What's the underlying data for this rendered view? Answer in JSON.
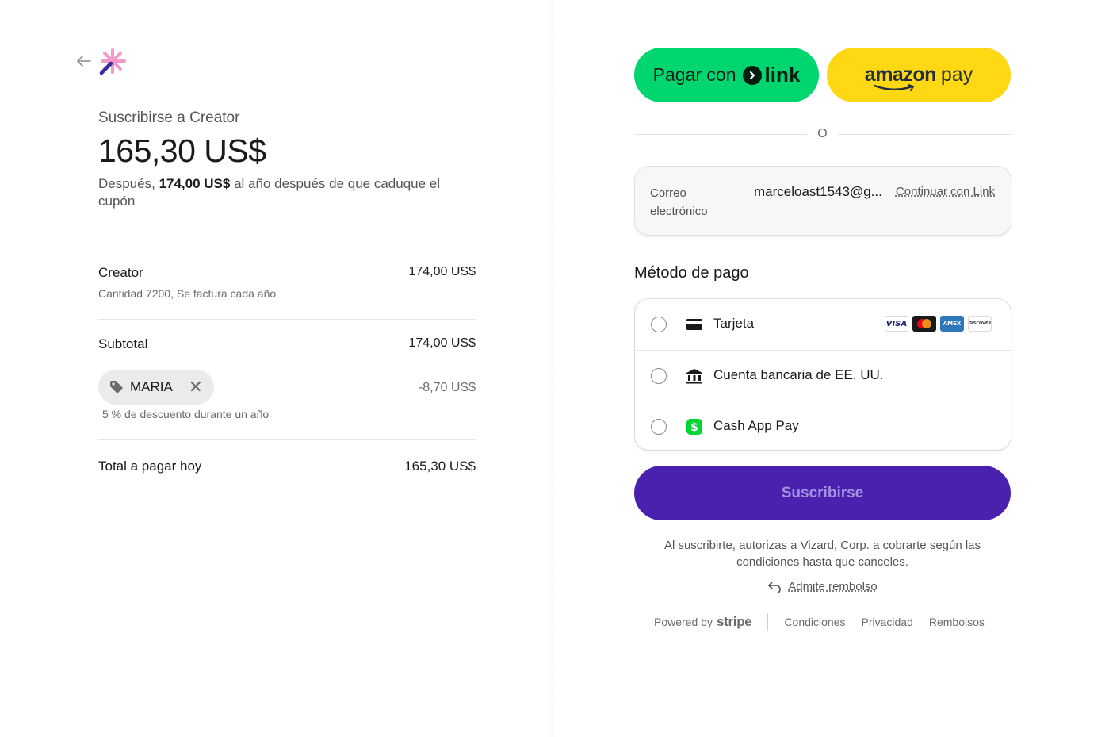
{
  "order": {
    "heading": "Suscribirse a Creator",
    "price": "165,30 US$",
    "after_prefix": "Después,",
    "after_amount": "174,00 US$",
    "after_suffix": "al año después de que caduque el cupón",
    "line_item": {
      "name": "Creator",
      "amount": "174,00 US$",
      "details": "Cantidad 7200, Se factura cada año"
    },
    "subtotal": {
      "label": "Subtotal",
      "amount": "174,00 US$"
    },
    "coupon": {
      "code": "MARIA",
      "discount": "-8,70 US$",
      "note": "5 % de descuento durante un año",
      "icon": "tag-icon",
      "remove_icon": "close-icon"
    },
    "total": {
      "label": "Total a pagar hoy",
      "amount": "165,30 US$"
    }
  },
  "wallets": {
    "link_prefix": "Pagar con",
    "link_word": "link",
    "amazon_word": "amazon",
    "amazon_pay": "pay",
    "separator": "O"
  },
  "email": {
    "label": "Correo electrónico",
    "value": "marceloast1543@g...",
    "link": "Continuar con Link"
  },
  "payment": {
    "title": "Método de pago",
    "methods": [
      {
        "label": "Tarjeta",
        "icon": "credit-card-icon"
      },
      {
        "label": "Cuenta bancaria de EE. UU.",
        "icon": "bank-icon"
      },
      {
        "label": "Cash App Pay",
        "icon": "cash-app-icon"
      }
    ],
    "card_brands": [
      "VISA",
      "Mastercard",
      "AMEX",
      "DISCOVER"
    ]
  },
  "subscribe": {
    "label": "Suscribirse"
  },
  "legal": {
    "auth_text": "Al suscribirte, autorizas a Vizard, Corp. a cobrarte según las condiciones hasta que canceles.",
    "refund_link": "Admite rembolso"
  },
  "footer": {
    "powered_by": "Powered by",
    "stripe": "stripe",
    "links": [
      "Condiciones",
      "Privacidad",
      "Rembolsos"
    ]
  },
  "colors": {
    "link_green": "#00d66f",
    "amazon_yellow": "#ffd814",
    "subscribe_purple": "#4a21ae"
  }
}
